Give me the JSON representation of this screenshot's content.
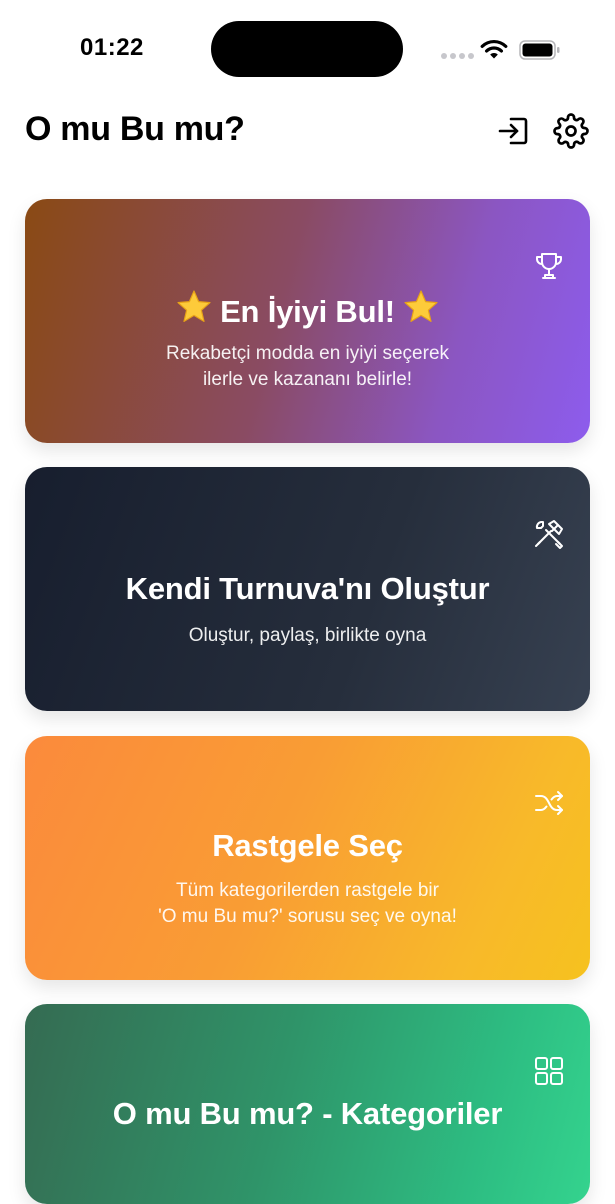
{
  "status_bar": {
    "time": "01:22"
  },
  "header": {
    "title": "O mu Bu mu?"
  },
  "cards": [
    {
      "title": "En İyiyi Bul!",
      "subtitle_lines": [
        "Rekabetçi modda en iyiyi seçerek",
        "ilerle ve kazananı belirle!"
      ],
      "icon": "trophy-icon",
      "decoration": "star-icon"
    },
    {
      "title": "Kendi Turnuva'nı Oluştur",
      "subtitle_lines": [
        "Oluştur, paylaş, birlikte oyna"
      ],
      "icon": "tools-icon"
    },
    {
      "title": "Rastgele Seç",
      "subtitle_lines": [
        "Tüm kategorilerden rastgele bir",
        "'O mu Bu mu?' sorusu seç ve oyna!"
      ],
      "icon": "shuffle-icon"
    },
    {
      "title": "O mu Bu mu? - Kategoriler",
      "subtitle_lines": [],
      "icon": "grid-icon"
    }
  ],
  "colors": {
    "champion_gradient": [
      "#8a4a14",
      "#8d5ced"
    ],
    "tournament_gradient": [
      "#171e2e",
      "#374151"
    ],
    "random_gradient": [
      "#fb8a3c",
      "#f6c21f"
    ],
    "categories_gradient": [
      "#356b52",
      "#34d38e"
    ]
  }
}
